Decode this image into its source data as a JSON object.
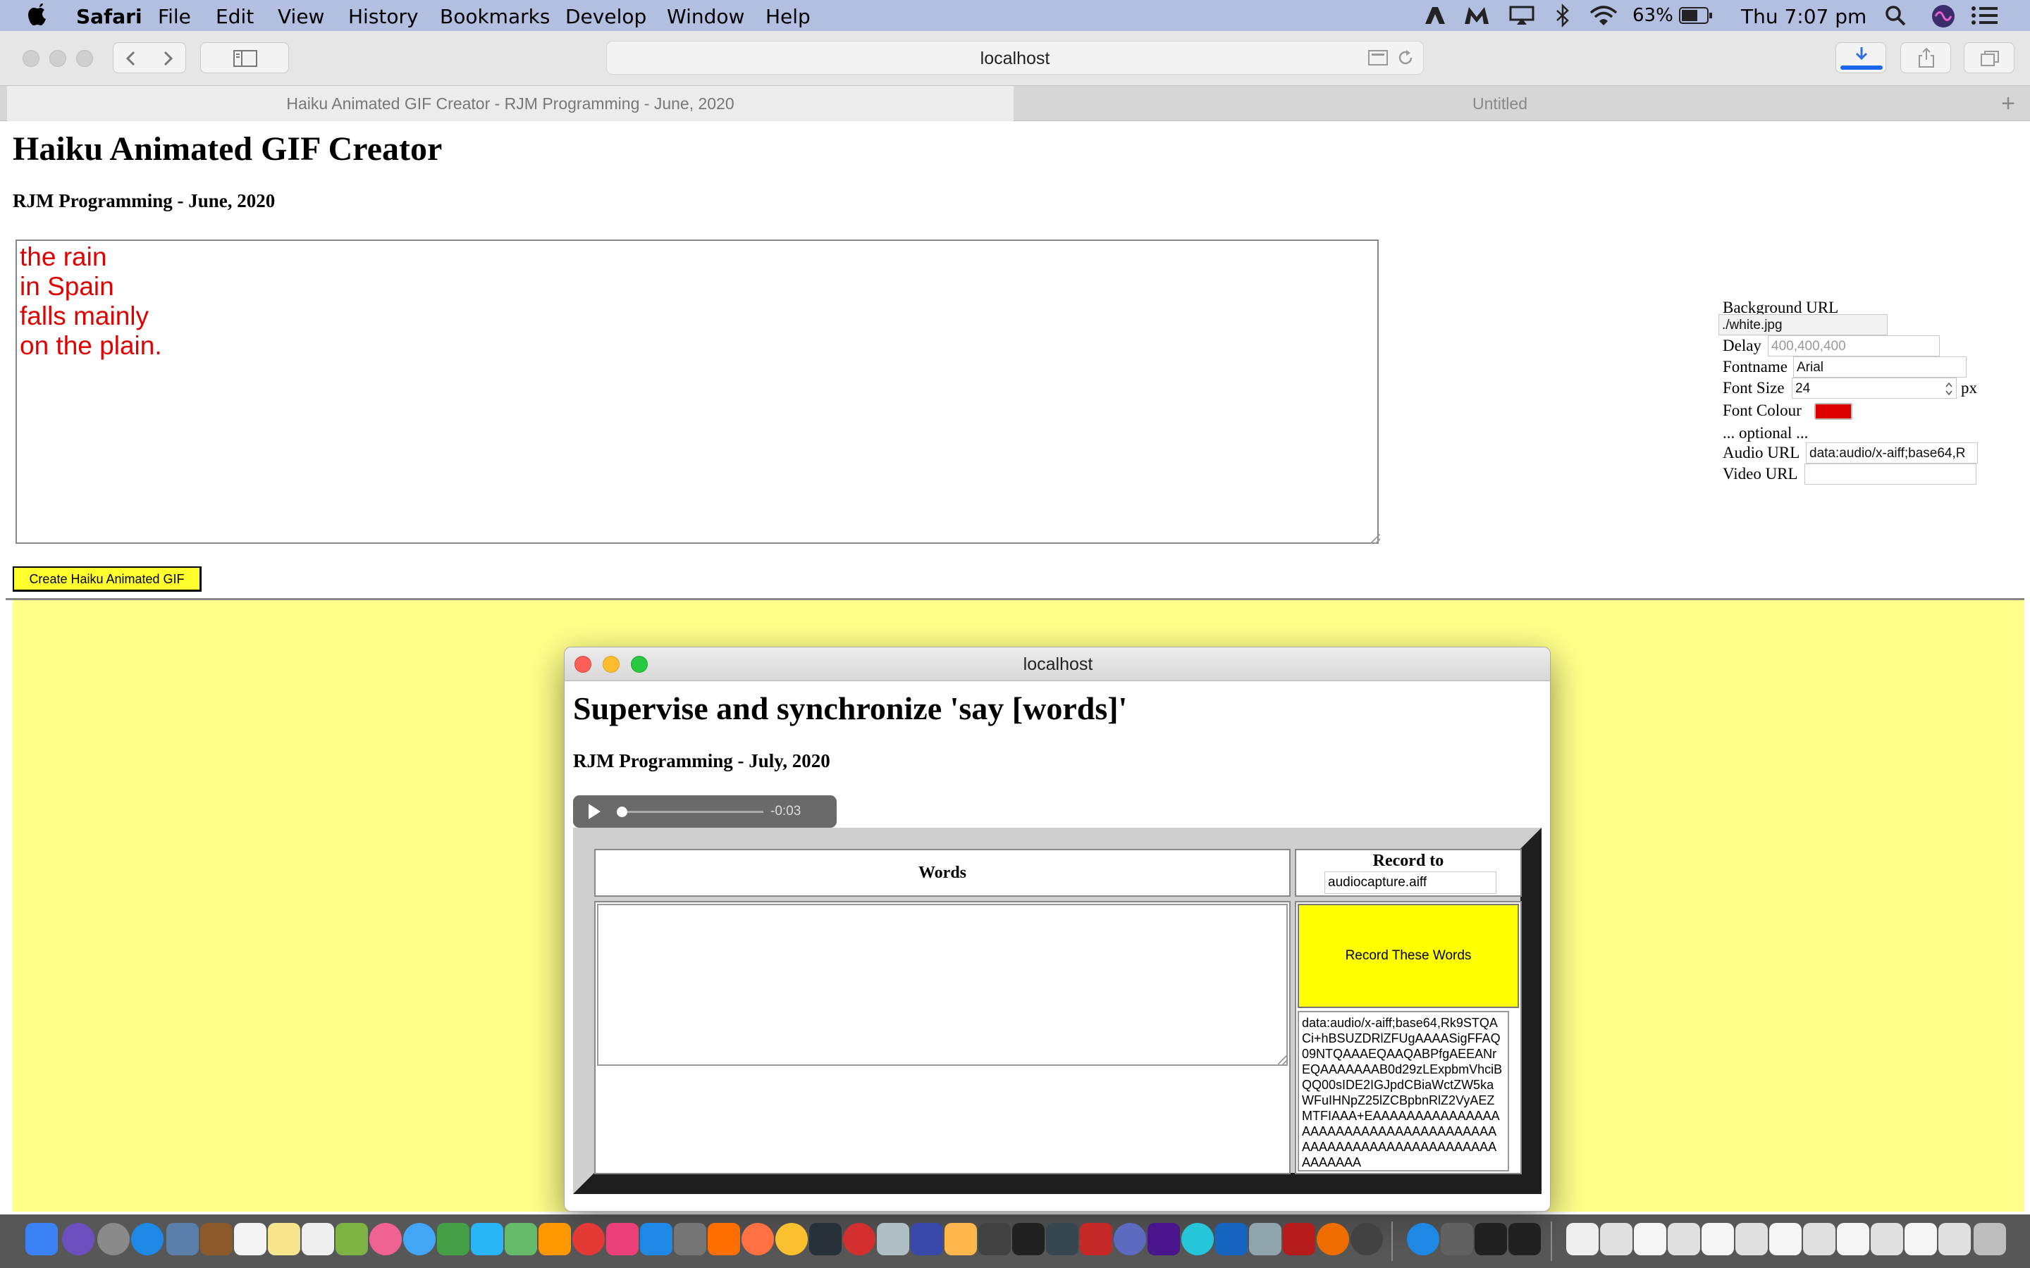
{
  "menubar": {
    "app": "Safari",
    "menus": [
      "File",
      "Edit",
      "View",
      "History",
      "Bookmarks",
      "Develop",
      "Window",
      "Help"
    ],
    "battery": "63%",
    "clock": "Thu 7:07 pm"
  },
  "browser": {
    "url": "localhost",
    "tabs": [
      "Haiku Animated GIF Creator - RJM Programming - June, 2020",
      "Untitled"
    ],
    "new_tab": "+"
  },
  "page": {
    "title": "Haiku Animated GIF Creator",
    "subtitle": "RJM Programming - June, 2020",
    "haiku_text": "the rain\nin Spain\nfalls mainly\non the plain.",
    "create_button": "Create Haiku Animated GIF",
    "form": {
      "background_label": "Background URL",
      "background_value": "./white.jpg",
      "delay_label": "Delay",
      "delay_placeholder": "400,400,400",
      "fontname_label": "Fontname",
      "fontname_value": "Arial",
      "fontsize_label": "Font Size",
      "fontsize_value": "24",
      "fontsize_unit": "px",
      "fontcolour_label": "Font Colour",
      "fontcolour_value": "#e00000",
      "optional_label": "... optional ...",
      "audio_label": "Audio URL",
      "audio_value": "data:audio/x-aiff;base64,R",
      "video_label": "Video URL",
      "video_value": ""
    }
  },
  "popup": {
    "window_title": "localhost",
    "title": "Supervise and synchronize 'say [words]'",
    "subtitle": "RJM Programming - July, 2020",
    "audio_time": "-0:03",
    "audio_progress": 0.0,
    "words_header": "Words",
    "record_header": "Record to",
    "record_filename": "audiocapture.aiff",
    "record_button": "Record These Words",
    "audio_data": "data:audio/x-aiff;base64,Rk9STQACi+hBSUZDRlZFUgAAAASigFFAQ09NTQAAAEQAAQABPfgAEEANrEQAAAAAAAB0d29zLExpbmVhciBQQ00sIDE2IGJpdCBiaWctZW5kaWFuIHNpZ25lZCBpbnRlZ2VyAEZMTFIAAA+EAAAAAAAAAAAAAAAAAAAAAAAAAAAAAAAAAAAAAAAAAAAAAAAAAAAAAAAAAAAAAAAAAAAA"
  }
}
